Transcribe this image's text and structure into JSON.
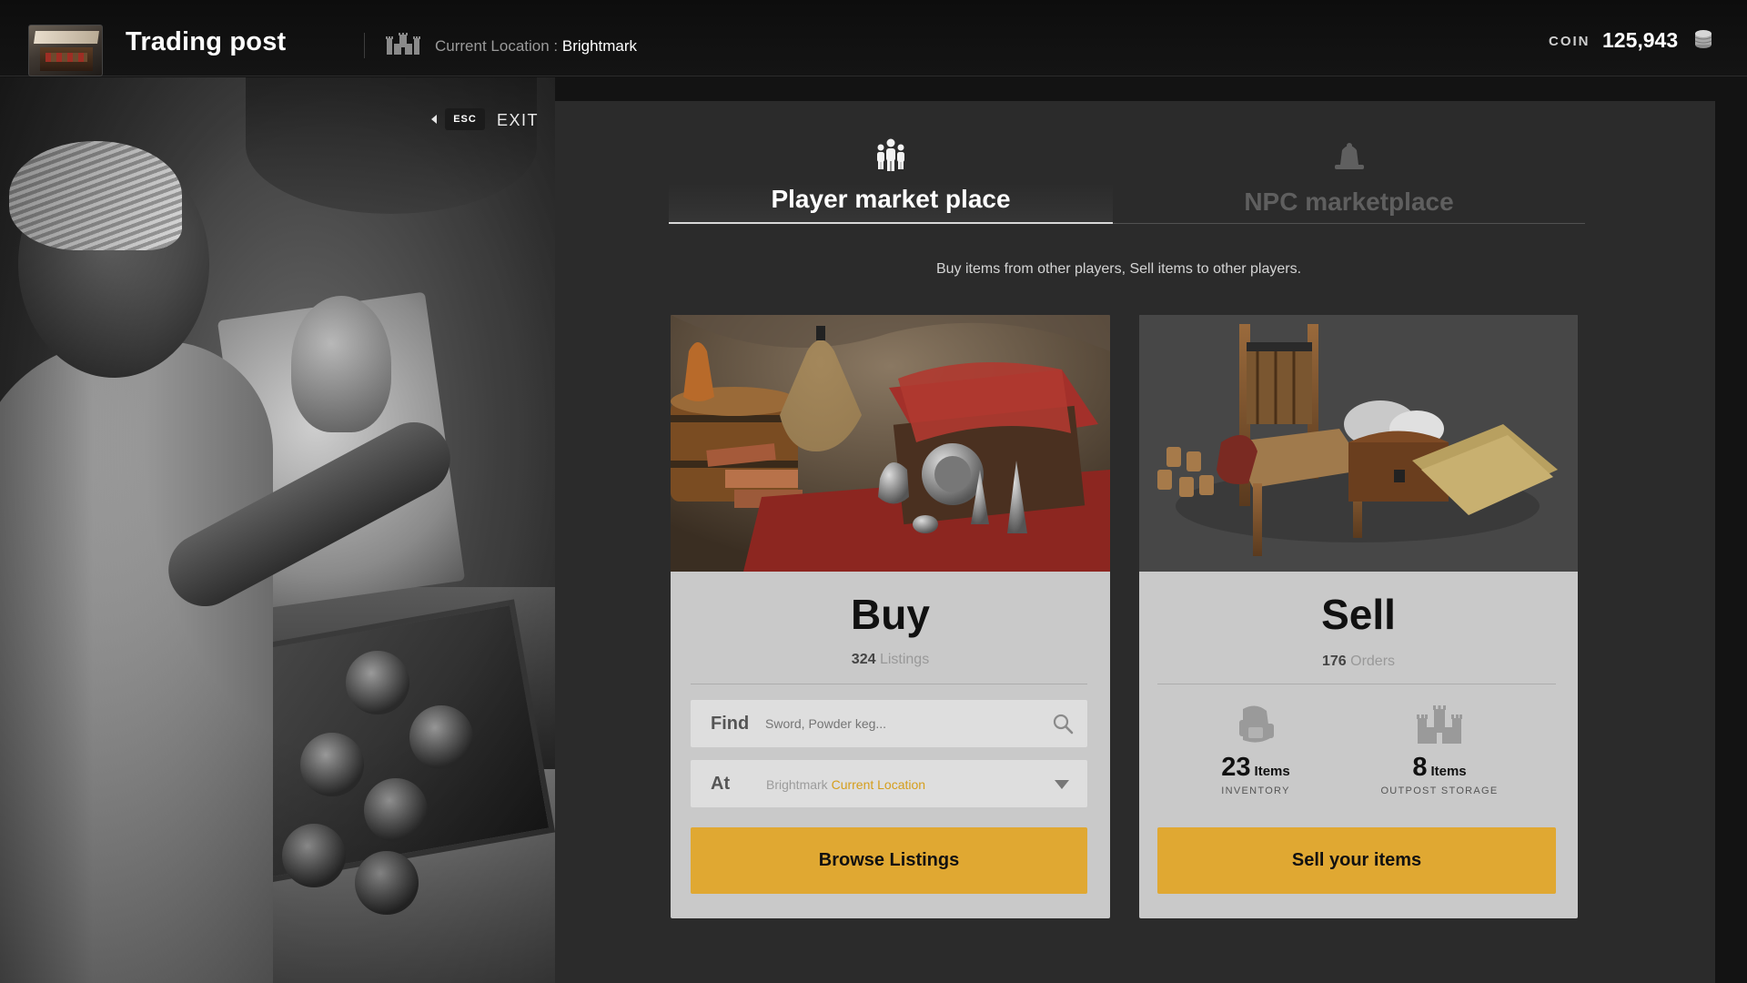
{
  "header": {
    "title": "Trading post",
    "location_label": "Current Location : ",
    "location_value": "Brightmark",
    "coin_label": "COIN",
    "coin_value": "125,943"
  },
  "exit": {
    "key": "ESC",
    "label": "EXIT"
  },
  "tabs": [
    {
      "label": "Player market place",
      "active": true,
      "icon": "people-icon"
    },
    {
      "label": "NPC marketplace",
      "active": false,
      "icon": "merchant-icon"
    }
  ],
  "subtitle": "Buy items from other players, Sell items to other players.",
  "buy": {
    "title": "Buy",
    "count": "324",
    "count_label": "Listings",
    "find_label": "Find",
    "find_placeholder": "Sword, Powder keg...",
    "at_label": "At",
    "at_location": "Brightmark",
    "at_location_note": "Current Location",
    "button": "Browse Listings"
  },
  "sell": {
    "title": "Sell",
    "count": "176",
    "count_label": "Orders",
    "inventory_count": "23",
    "inventory_unit": "Items",
    "inventory_caption": "INVENTORY",
    "storage_count": "8",
    "storage_unit": "Items",
    "storage_caption": "OUTPOST STORAGE",
    "button": "Sell your items"
  },
  "colors": {
    "accent": "#e0a832",
    "location_highlight": "#d59e1c",
    "panel": "#2b2b2b",
    "card": "#c9c9c9"
  }
}
